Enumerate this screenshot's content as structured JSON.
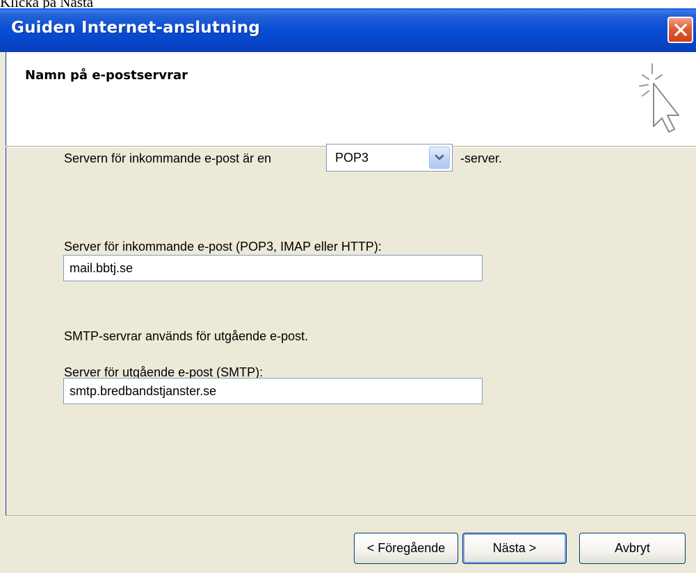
{
  "caption": "Klicka på Nästa",
  "window": {
    "title": "Guiden Internet-anslutning"
  },
  "header": {
    "title": "Namn på e-postservrar",
    "icon": "wizard-cursor-icon"
  },
  "form": {
    "server_type_label": "Servern för inkommande e-post är en",
    "server_type_value": "POP3",
    "server_type_suffix": "-server.",
    "incoming_label": "Server för inkommande e-post (POP3, IMAP eller HTTP):",
    "incoming_value": "mail.bbtj.se",
    "smtp_info": "SMTP-servrar används för utgående e-post.",
    "outgoing_label": "Server för utgående e-post (SMTP):",
    "outgoing_value": "smtp.bredbandstjanster.se"
  },
  "buttons": {
    "back": "< Föregående",
    "next": "Nästa >",
    "cancel": "Avbryt"
  },
  "colors": {
    "titlebar": "#0a4fd6",
    "dialog_bg": "#ece9d8",
    "close": "#e2603d"
  }
}
